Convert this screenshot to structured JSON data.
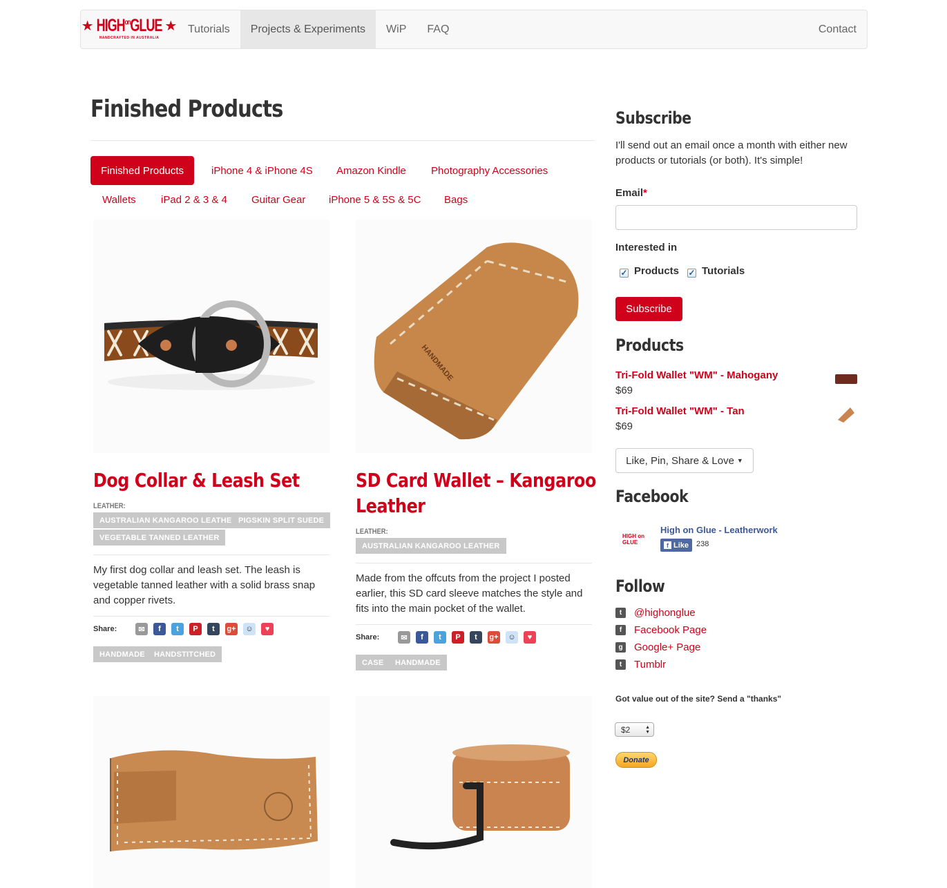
{
  "brand": {
    "name": "HIGH on GLUE",
    "word1": "HIGH",
    "word2": "on",
    "word3": "GLUE",
    "tagline": "HANDCRAFTED IN AUSTRALIA"
  },
  "nav": {
    "items": [
      "Tutorials",
      "Projects & Experiments",
      "WiP",
      "FAQ"
    ],
    "active": "Projects & Experiments",
    "right": "Contact"
  },
  "page": {
    "title": "Finished Products"
  },
  "filters": [
    "Finished Products",
    "iPhone 4 & iPhone 4S",
    "Amazon Kindle",
    "Photography Accessories",
    "Wallets",
    "iPad 2 & 3 & 4",
    "Guitar Gear",
    "iPhone 5 & 5S & 5C",
    "Bags"
  ],
  "products": [
    {
      "title": "Dog Collar & Leash Set",
      "meta_label": "LEATHER:",
      "leather_tags": [
        "AUSTRALIAN KANGAROO LEATHER",
        "PIGSKIN SPLIT SUEDE",
        "VEGETABLE TANNED LEATHER"
      ],
      "description": "My first dog collar and leash set. The leash is vegetable tanned leather with a solid brass snap and copper rivets.",
      "share_label": "Share:",
      "tags": [
        "HANDMADE",
        "HANDSTITCHED"
      ]
    },
    {
      "title_line1": "SD Card Wallet – Kangaroo",
      "title_line2": "Leather",
      "meta_label": "LEATHER:",
      "leather_tags": [
        "AUSTRALIAN KANGAROO LEATHER"
      ],
      "description": "Made from the offcuts from the project I posted earlier, this SD card sleeve matches the style and fits into the main pocket of the wallet.",
      "share_label": "Share:",
      "tags": [
        "CASE",
        "HANDMADE"
      ]
    }
  ],
  "sidebar": {
    "subscribe": {
      "heading": "Subscribe",
      "text": "I'll send out an email once a month with either new products or tutorials (or both). It's simple!",
      "email_label": "Email",
      "required_mark": "*",
      "interested_label": "Interested in",
      "options": [
        "Products",
        "Tutorials"
      ],
      "button": "Subscribe"
    },
    "products": {
      "heading": "Products",
      "items": [
        {
          "name": "Tri-Fold Wallet \"WM\" - Mahogany",
          "price": "$69"
        },
        {
          "name": "Tri-Fold Wallet \"WM\" - Tan",
          "price": "$69"
        }
      ],
      "share_button": "Like, Pin, Share & Love"
    },
    "facebook": {
      "heading": "Facebook",
      "page_name": "High on Glue - Leatherwork",
      "like_label": "Like",
      "like_count": "238"
    },
    "follow": {
      "heading": "Follow",
      "links": [
        {
          "label": "@highonglue",
          "icon": "twitter-icon"
        },
        {
          "label": "Facebook Page",
          "icon": "facebook-icon"
        },
        {
          "label": "Google+ Page",
          "icon": "google-plus-icon"
        },
        {
          "label": "Tumblr",
          "icon": "tumblr-icon"
        }
      ]
    },
    "donate": {
      "text": "Got value out of the site? Send a \"thanks\"",
      "amount": "$2",
      "button": "Donate"
    }
  },
  "colors": {
    "accent": "#d0021b",
    "tag_bg": "#c8c8c8",
    "nav_bg": "#f8f8f8"
  }
}
